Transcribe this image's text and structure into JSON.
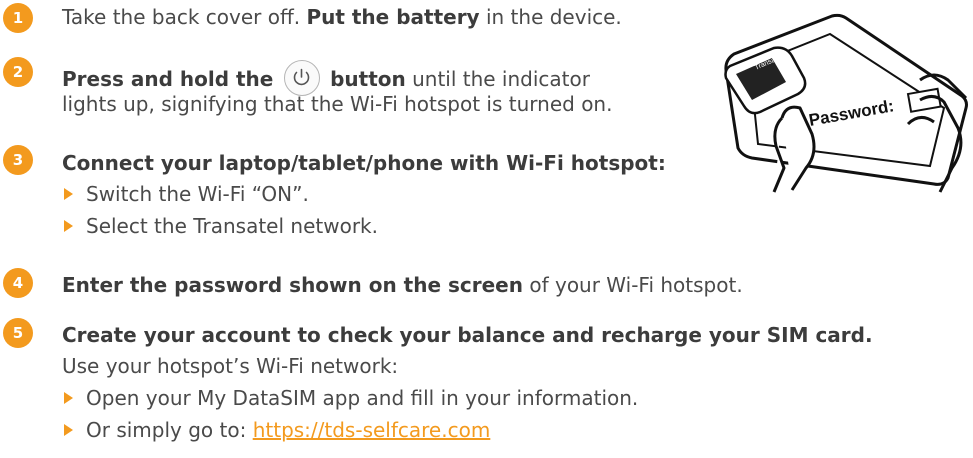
{
  "steps": [
    {
      "number": "1",
      "pre": "Take the back cover off. ",
      "bold": "Put the battery",
      "post": " in the device."
    },
    {
      "number": "2",
      "bold1": "Press and hold the",
      "button_icon": "power-icon",
      "bold2": "button",
      "post": " until the indicator",
      "line2": "lights up, signifying that the Wi-Fi hotspot is turned on."
    },
    {
      "number": "3",
      "bold": "Connect your laptop/tablet/phone with Wi-Fi hotspot:",
      "bullets": [
        "Switch the Wi-Fi “ON”.",
        "Select the Transatel network."
      ]
    },
    {
      "number": "4",
      "bold": "Enter the password shown on the screen",
      "post": " of your Wi-Fi hotspot."
    },
    {
      "number": "5",
      "bold": "Create your account to check your balance and recharge your SIM card.",
      "line2": "Use your hotspot’s Wi-Fi network:",
      "bullets": [
        "Open your My DataSIM app and fill in your information.",
        "Or simply go to: "
      ],
      "link": "https://tds-selfcare.com"
    }
  ],
  "illustration": {
    "label_password": "Password:",
    "label_device": "Transatel",
    "icon": "hands-holding-hotspot-illustration"
  },
  "colors": {
    "accent": "#f39a1e",
    "text": "#4a4a4a"
  }
}
